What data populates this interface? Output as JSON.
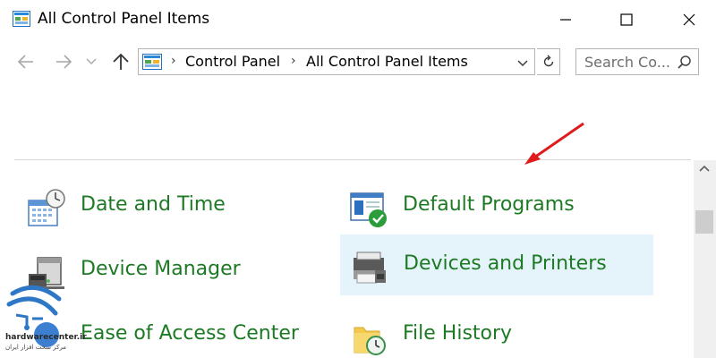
{
  "window": {
    "title": "All Control Panel Items",
    "controls": {
      "minimize": "minimize",
      "maximize": "maximize",
      "close": "close"
    }
  },
  "navigation": {
    "breadcrumbs": [
      "Control Panel",
      "All Control Panel Items"
    ],
    "search_placeholder": "Search Co..."
  },
  "items": [
    {
      "label": "Date and Time",
      "icon": "date-time-icon"
    },
    {
      "label": "Default Programs",
      "icon": "default-programs-icon"
    },
    {
      "label": "Device Manager",
      "icon": "device-manager-icon"
    },
    {
      "label": "Devices and Printers",
      "icon": "devices-printers-icon",
      "highlighted": true
    },
    {
      "label": "Ease of Access Center",
      "icon": "ease-of-access-icon"
    },
    {
      "label": "File History",
      "icon": "file-history-icon"
    }
  ],
  "watermark": {
    "text": "hardwarecenter.ir",
    "subtext": "مرکز سخت افزار ایران"
  },
  "colors": {
    "link_green": "#1d7a24",
    "highlight": "#e5f3fb",
    "arrow_red": "#e01b1b"
  }
}
